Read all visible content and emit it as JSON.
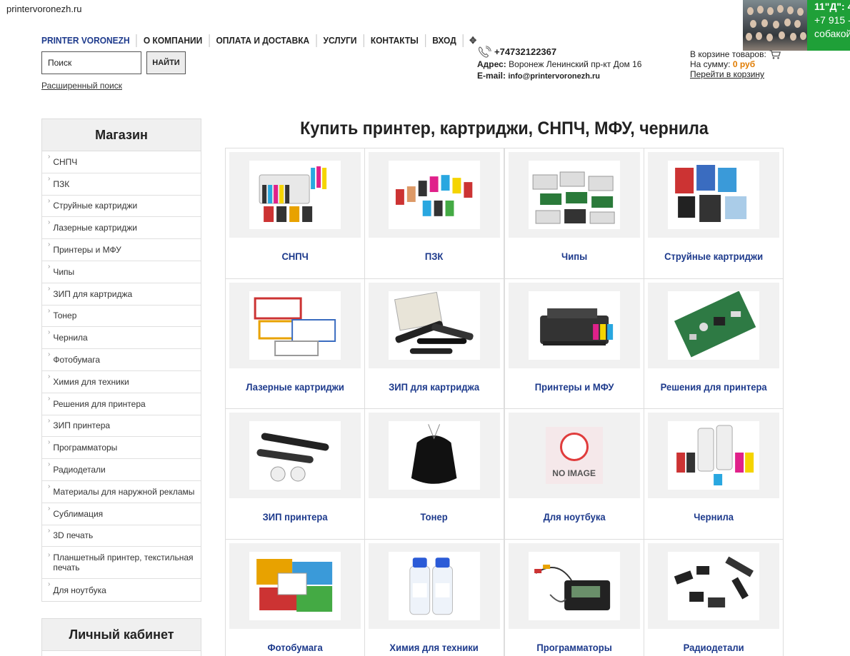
{
  "site_url": "printervoronezh.ru",
  "promo": {
    "line1": "11\"Д\": 4",
    "line2": "+7 915 -",
    "line3": "собакой"
  },
  "nav": {
    "brand": "PRINTER VORONEZH",
    "items": [
      "О КОМПАНИИ",
      "ОПЛАТА И ДОСТАВКА",
      "УСЛУГИ",
      "КОНТАКТЫ",
      "ВХОД"
    ],
    "move_icon": "✥"
  },
  "search": {
    "value": "Поиск",
    "button": "НАЙТИ",
    "advanced": "Расширенный поиск"
  },
  "contact": {
    "phone": "+74732122367",
    "address_label": "Адрес:",
    "address": "Воронеж Ленинский пр-кт Дом 16",
    "email_label": "E-mail:",
    "email": "info@printervoronezh.ru"
  },
  "cart": {
    "items_label": "В корзине товаров:",
    "sum_label": "На сумму:",
    "sum_value": "0 руб",
    "link": "Перейти в корзину"
  },
  "sidebar": {
    "title": "Магазин",
    "items": [
      "СНПЧ",
      "ПЗК",
      "Струйные картриджи",
      "Лазерные картриджи",
      "Принтеры и МФУ",
      "Чипы",
      "ЗИП для картриджа",
      "Тонер",
      "Чернила",
      "Фотобумага",
      "Химия для техники",
      "Решения для принтера",
      "ЗИП принтера",
      "Программаторы",
      "Радиодетали",
      "Материалы для наружной рекламы",
      "Сублимация",
      "3D печать",
      "Планшетный принтер, текстильная печать",
      "Для ноутбука"
    ]
  },
  "cabinet": {
    "title": "Личный кабинет"
  },
  "main": {
    "title": "Купить принтер, картриджи, СНПЧ, МФУ, чернила",
    "noimage_text": "NO IMAGE",
    "products": [
      {
        "label": "СНПЧ",
        "icon": "ciss-image"
      },
      {
        "label": "ПЗК",
        "icon": "refillable-cartridges-image"
      },
      {
        "label": "Чипы",
        "icon": "chips-image"
      },
      {
        "label": "Струйные картриджи",
        "icon": "inkjet-cartridges-image"
      },
      {
        "label": "Лазерные картриджи",
        "icon": "laser-cartridges-image"
      },
      {
        "label": "ЗИП для картриджа",
        "icon": "cartridge-parts-image"
      },
      {
        "label": "Принтеры и МФУ",
        "icon": "printer-image"
      },
      {
        "label": "Решения для принтера",
        "icon": "circuit-board-image"
      },
      {
        "label": "ЗИП принтера",
        "icon": "printer-parts-image"
      },
      {
        "label": "Тонер",
        "icon": "toner-bag-image"
      },
      {
        "label": "Для ноутбука",
        "icon": "no-image-placeholder"
      },
      {
        "label": "Чернила",
        "icon": "ink-bottles-image"
      },
      {
        "label": "Фотобумага",
        "icon": "photo-paper-image"
      },
      {
        "label": "Химия для техники",
        "icon": "cleaning-fluid-image"
      },
      {
        "label": "Программаторы",
        "icon": "programmer-device-image"
      },
      {
        "label": "Радиодетали",
        "icon": "radio-components-image"
      }
    ]
  }
}
